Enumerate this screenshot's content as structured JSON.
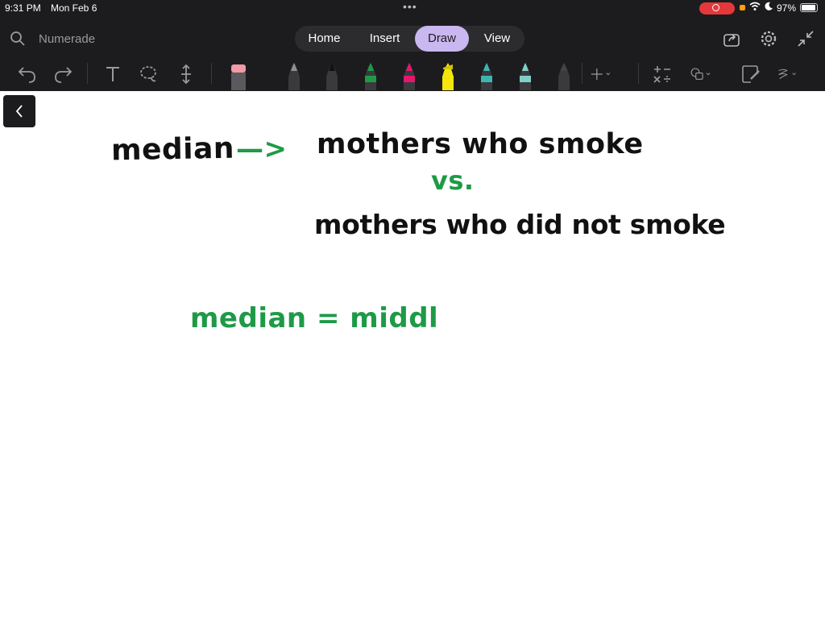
{
  "status": {
    "time": "9:31 PM",
    "date": "Mon Feb 6",
    "battery_pct": "97%",
    "battery_level": 0.97,
    "dots": "•••"
  },
  "search": {
    "label": "Numerade",
    "icon": "search-icon"
  },
  "tabs": [
    {
      "label": "Home",
      "active": false
    },
    {
      "label": "Insert",
      "active": false
    },
    {
      "label": "Draw",
      "active": true
    },
    {
      "label": "View",
      "active": false
    }
  ],
  "right_icons": [
    "share-icon",
    "settings-icon",
    "collapse-icon"
  ],
  "tools": [
    "undo-icon",
    "redo-icon",
    "text-tool-icon",
    "lasso-icon",
    "insert-space-icon",
    "eraser-icon"
  ],
  "pens": [
    {
      "name": "pen-gray-a",
      "color": "#8e8e93"
    },
    {
      "name": "pen-black",
      "color": "#111111"
    },
    {
      "name": "pen-green",
      "color": "#1e9a47"
    },
    {
      "name": "pen-pink",
      "color": "#e5166e"
    },
    {
      "name": "highlighter-yellow",
      "color": "#f5e50a"
    },
    {
      "name": "pen-galaxy",
      "color": "#3bb7b2"
    },
    {
      "name": "pen-teal",
      "color": "#7fd0c9"
    },
    {
      "name": "pen-dark",
      "color": "#444444"
    }
  ],
  "colors": {
    "ink_black": "#111111",
    "ink_green": "#1e9a47",
    "active_tab": "#c9b7f0",
    "toolbar": "#1c1c1e"
  },
  "canvas": {
    "word_median": "median",
    "arrow": "—>",
    "line1": "mothers who smoke",
    "vs": "vs.",
    "line2": "mothers who did not smoke",
    "line3": "median = middl"
  }
}
